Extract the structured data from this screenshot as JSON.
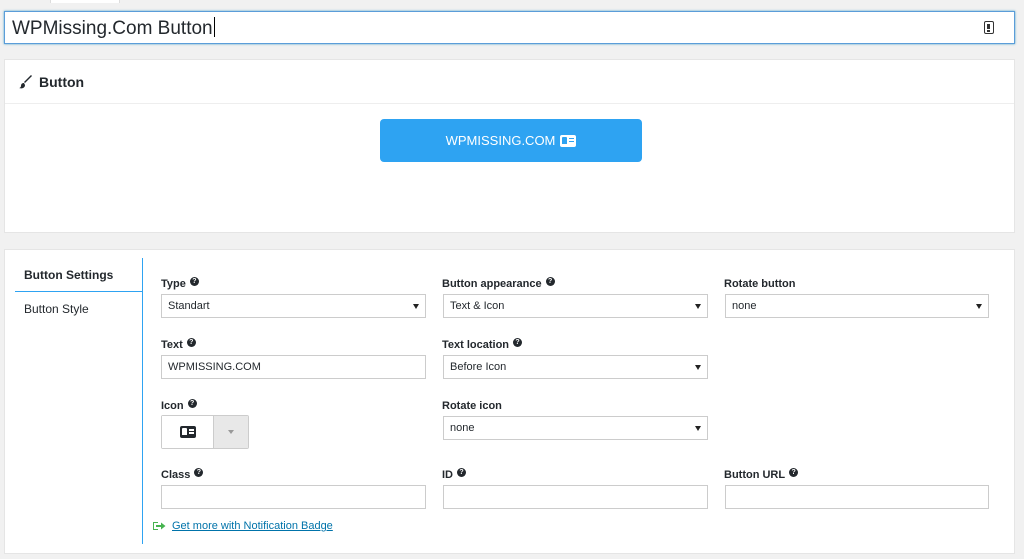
{
  "title_input": {
    "value": "WPMissing.Com Button",
    "icon": "toolbar-icon"
  },
  "preview": {
    "header_title": "Button",
    "header_icon": "brush-icon",
    "demo_button_label": "WPMISSING.COM",
    "demo_button_icon": "id-card-icon",
    "colors": {
      "button_bg": "#2ea3f2",
      "button_text": "#ffffff"
    }
  },
  "settings": {
    "tabs": [
      {
        "label": "Button Settings",
        "active": true
      },
      {
        "label": "Button Style",
        "active": false
      }
    ],
    "fields": {
      "type": {
        "label": "Type",
        "value": "Standart"
      },
      "button_appearance": {
        "label": "Button appearance",
        "value": "Text & Icon"
      },
      "rotate_button": {
        "label": "Rotate button",
        "value": "none"
      },
      "text": {
        "label": "Text",
        "value": "WPMISSING.COM"
      },
      "text_location": {
        "label": "Text location",
        "value": "Before Icon"
      },
      "icon": {
        "label": "Icon",
        "value": "id-card-icon"
      },
      "rotate_icon": {
        "label": "Rotate icon",
        "value": "none"
      },
      "class": {
        "label": "Class",
        "value": ""
      },
      "id": {
        "label": "ID",
        "value": ""
      },
      "button_url": {
        "label": "Button URL",
        "value": ""
      }
    },
    "promo_link": "Get more with Notification Badge",
    "help_glyph": "?"
  }
}
